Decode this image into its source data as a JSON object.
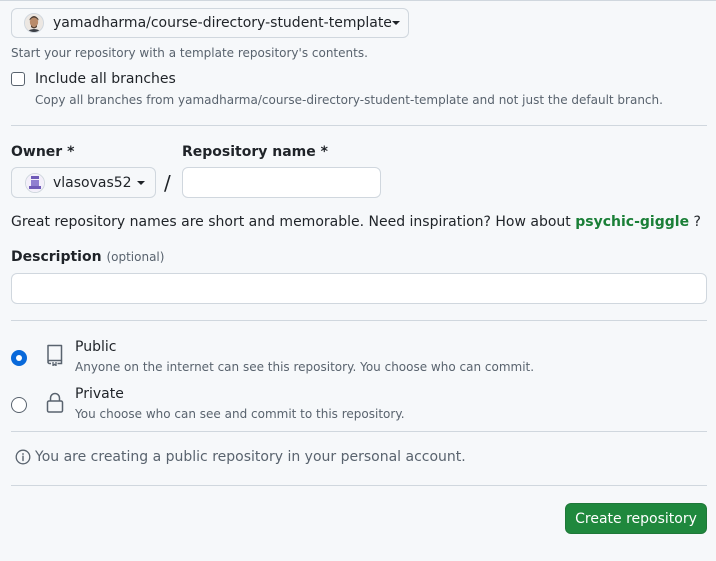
{
  "template": {
    "repo": "yamadharma/course-directory-student-template",
    "helper": "Start your repository with a template repository's contents.",
    "include_branches_label": "Include all branches",
    "include_branches_note": "Copy all branches from yamadharma/course-directory-student-template and not just the default branch.",
    "include_branches_checked": false,
    "avatar_icon": "user-avatar"
  },
  "owner": {
    "label": "Owner *",
    "value": "vlasovas52",
    "avatar_icon": "identicon-avatar"
  },
  "separator": "/",
  "repo_name": {
    "label": "Repository name *",
    "value": ""
  },
  "inspiration": {
    "text": "Great repository names are short and memorable. Need inspiration? How about",
    "suggestion": "psychic-giggle",
    "end": "?"
  },
  "description": {
    "label": "Description",
    "optional": "(optional)",
    "value": ""
  },
  "visibility": {
    "selected": "public",
    "public": {
      "title": "Public",
      "desc": "Anyone on the internet can see this repository. You choose who can commit.",
      "icon": "repo-icon"
    },
    "private": {
      "title": "Private",
      "desc": "You choose who can see and commit to this repository.",
      "icon": "lock-icon"
    }
  },
  "info_text": "You are creating a public repository in your personal account.",
  "create_label": "Create repository",
  "colors": {
    "accent": "#0969da",
    "primary_button": "#1f883d",
    "suggestion": "#1a7f37",
    "muted": "#59636e",
    "border": "#d0d7de"
  }
}
